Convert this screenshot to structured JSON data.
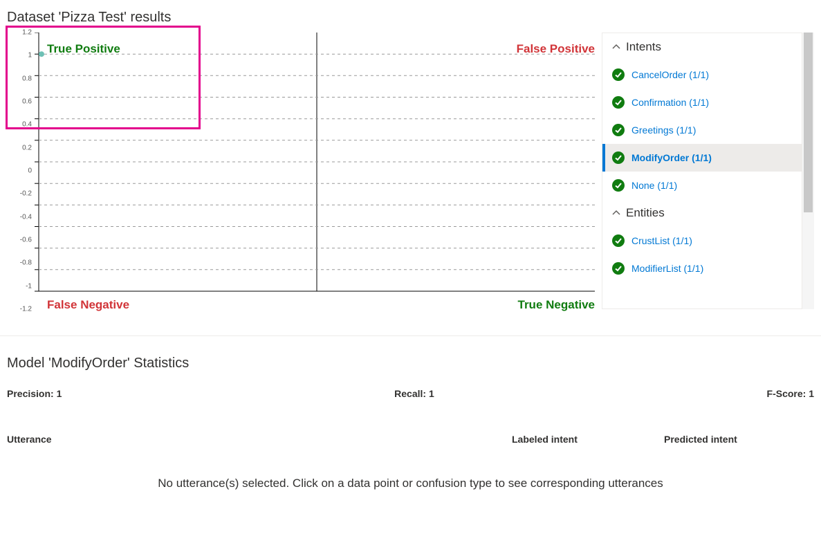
{
  "header": {
    "title": "Dataset 'Pizza Test' results"
  },
  "chart_data": {
    "type": "scatter",
    "ylim": [
      -1.2,
      1.2
    ],
    "yticks": [
      1.2,
      1,
      0.8,
      0.6,
      0.4,
      0.2,
      0,
      -0.2,
      -0.4,
      -0.6,
      -0.8,
      -1,
      -1.2
    ],
    "points": [
      {
        "x": 0,
        "y": 1
      }
    ],
    "quadrants": {
      "top_left": "True Positive",
      "top_right": "False Positive",
      "bottom_left": "False Negative",
      "bottom_right": "True Negative"
    }
  },
  "sidebar": {
    "sections": [
      {
        "title": "Intents",
        "items": [
          {
            "label": "CancelOrder (1/1)",
            "status": "ok"
          },
          {
            "label": "Confirmation (1/1)",
            "status": "ok"
          },
          {
            "label": "Greetings (1/1)",
            "status": "ok"
          },
          {
            "label": "ModifyOrder (1/1)",
            "status": "ok",
            "selected": true
          },
          {
            "label": "None (1/1)",
            "status": "ok"
          }
        ]
      },
      {
        "title": "Entities",
        "items": [
          {
            "label": "CrustList (1/1)",
            "status": "ok"
          },
          {
            "label": "ModifierList (1/1)",
            "status": "ok"
          }
        ]
      }
    ]
  },
  "stats": {
    "title": "Model 'ModifyOrder' Statistics",
    "precision_label": "Precision: 1",
    "recall_label": "Recall: 1",
    "fscore_label": "F-Score: 1"
  },
  "table": {
    "col1": "Utterance",
    "col2": "Labeled intent",
    "col3": "Predicted intent",
    "empty": "No utterance(s) selected. Click on a data point or confusion type to see corresponding utterances"
  }
}
